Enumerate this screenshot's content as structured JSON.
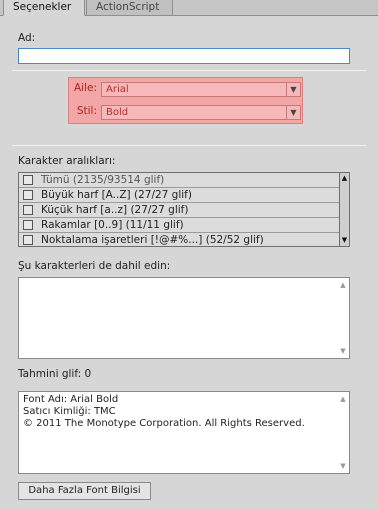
{
  "tabs": {
    "active": "Seçenekler",
    "inactive": "ActionScript"
  },
  "name_field": {
    "label": "Ad:",
    "value": ""
  },
  "font": {
    "family_label": "Aile:",
    "family_value": "Arial",
    "style_label": "Stil:",
    "style_value": "Bold"
  },
  "ranges": {
    "label": "Karakter aralıkları:",
    "items": [
      "Tümü  (2135/93514 glif)",
      "Büyük harf [A..Z]  (27/27 glif)",
      "Küçük harf [a..z]  (27/27 glif)",
      "Rakamlar [0..9]  (11/11 glif)",
      "Noktalama işaretleri [!@#%...]  (52/52 glif)"
    ]
  },
  "include": {
    "label": "Şu karakterleri de dahil edin:",
    "value": ""
  },
  "estimated": {
    "label": "Tahmini glif: 0"
  },
  "font_info": {
    "lines": [
      "Font Adı: Arial Bold",
      "Satıcı Kimliği: TMC",
      "© 2011 The Monotype Corporation. All Rights Reserved."
    ]
  },
  "more_button": "Daha Fazla Font Bilgisi"
}
